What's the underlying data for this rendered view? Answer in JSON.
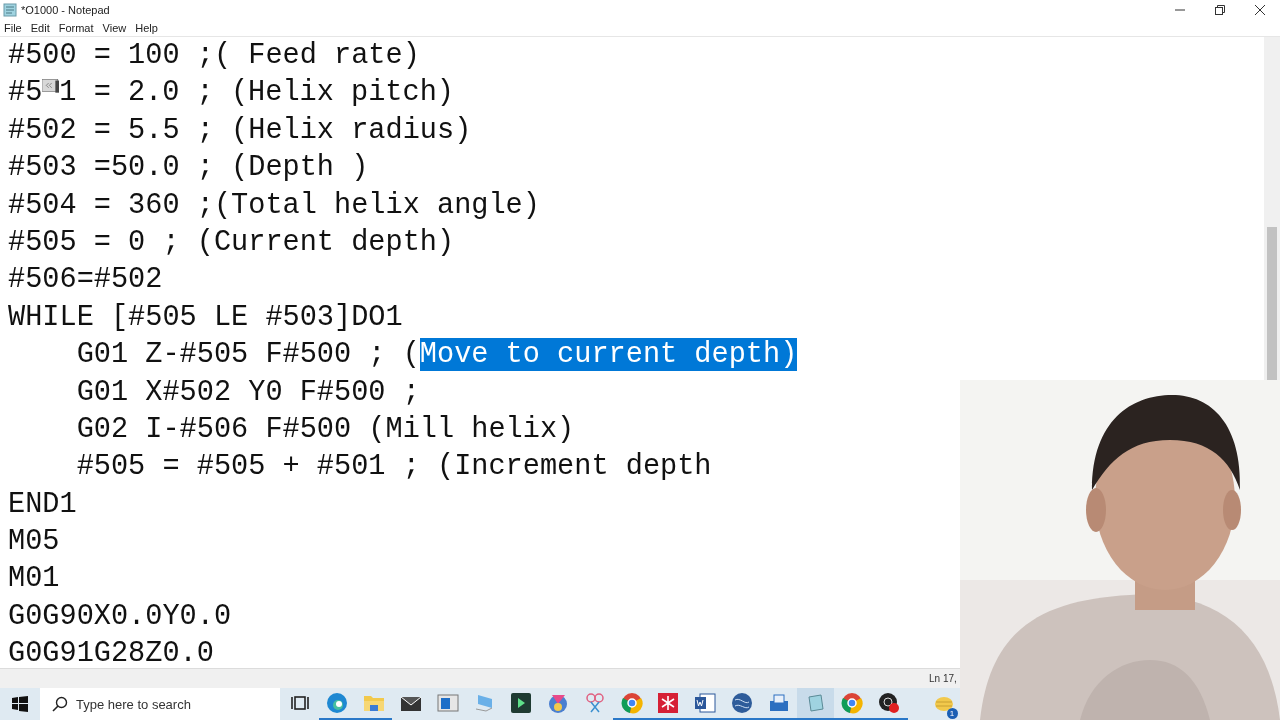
{
  "window": {
    "title": "*O1000 - Notepad"
  },
  "menu": [
    "File",
    "Edit",
    "Format",
    "View",
    "Help"
  ],
  "editor": {
    "lines": [
      [
        {
          "text": "#500 = 100 ;( Feed rate)",
          "selected": false
        }
      ],
      [
        {
          "text": "#5",
          "selected": false
        },
        {
          "kind": "icon"
        },
        {
          "text": "1 = 2.0 ; (Helix pitch)",
          "selected": false
        }
      ],
      [
        {
          "text": "#502 = 5.5 ; (Helix radius)",
          "selected": false
        }
      ],
      [
        {
          "text": "#503 =50.0 ; (Depth )",
          "selected": false
        }
      ],
      [
        {
          "text": "#504 = 360 ;(Total helix angle)",
          "selected": false
        }
      ],
      [
        {
          "text": "#505 = 0 ; (Current depth)",
          "selected": false
        }
      ],
      [
        {
          "text": "#506=#502",
          "selected": false
        }
      ],
      [
        {
          "text": "WHILE [#505 LE #503]DO1",
          "selected": false
        }
      ],
      [
        {
          "text": "    G01 Z-#505 F#500 ; (",
          "selected": false
        },
        {
          "text": "Move to current depth)",
          "selected": true
        }
      ],
      [
        {
          "text": "    G01 X#502 Y0 F#500 ;",
          "selected": false
        }
      ],
      [
        {
          "text": "    G02 I-#506 F#500 (Mill helix)",
          "selected": false
        }
      ],
      [
        {
          "text": "    #505 = #505 + #501 ; (Increment depth",
          "selected": false
        }
      ],
      [
        {
          "text": "END1",
          "selected": false
        }
      ],
      [
        {
          "text": "M05",
          "selected": false
        }
      ],
      [
        {
          "text": "M01",
          "selected": false
        }
      ],
      [
        {
          "text": "G0G90X0.0Y0.0",
          "selected": false
        }
      ],
      [
        {
          "text": "G0G91G28Z0.0",
          "selected": false
        }
      ]
    ]
  },
  "status_bar": {
    "position": "Ln 17,"
  },
  "taskbar": {
    "search": {
      "placeholder": "Type here to search"
    },
    "apps": [
      {
        "kind": "taskview",
        "running": false
      },
      {
        "kind": "edge",
        "running": true
      },
      {
        "kind": "folder",
        "running": true
      },
      {
        "kind": "mail",
        "running": false
      },
      {
        "kind": "window",
        "running": false
      },
      {
        "kind": "monitor",
        "running": false
      },
      {
        "kind": "player",
        "running": false
      },
      {
        "kind": "prism",
        "running": false
      },
      {
        "kind": "scissors",
        "running": false
      },
      {
        "kind": "chrome",
        "running": true
      },
      {
        "kind": "snowflake",
        "running": true
      },
      {
        "kind": "word",
        "running": true
      },
      {
        "kind": "globe",
        "running": true
      },
      {
        "kind": "printer",
        "running": true
      },
      {
        "kind": "notepad",
        "running": true
      },
      {
        "kind": "chrome",
        "running": true
      },
      {
        "kind": "record",
        "running": true
      }
    ],
    "tray_badge": "1"
  }
}
